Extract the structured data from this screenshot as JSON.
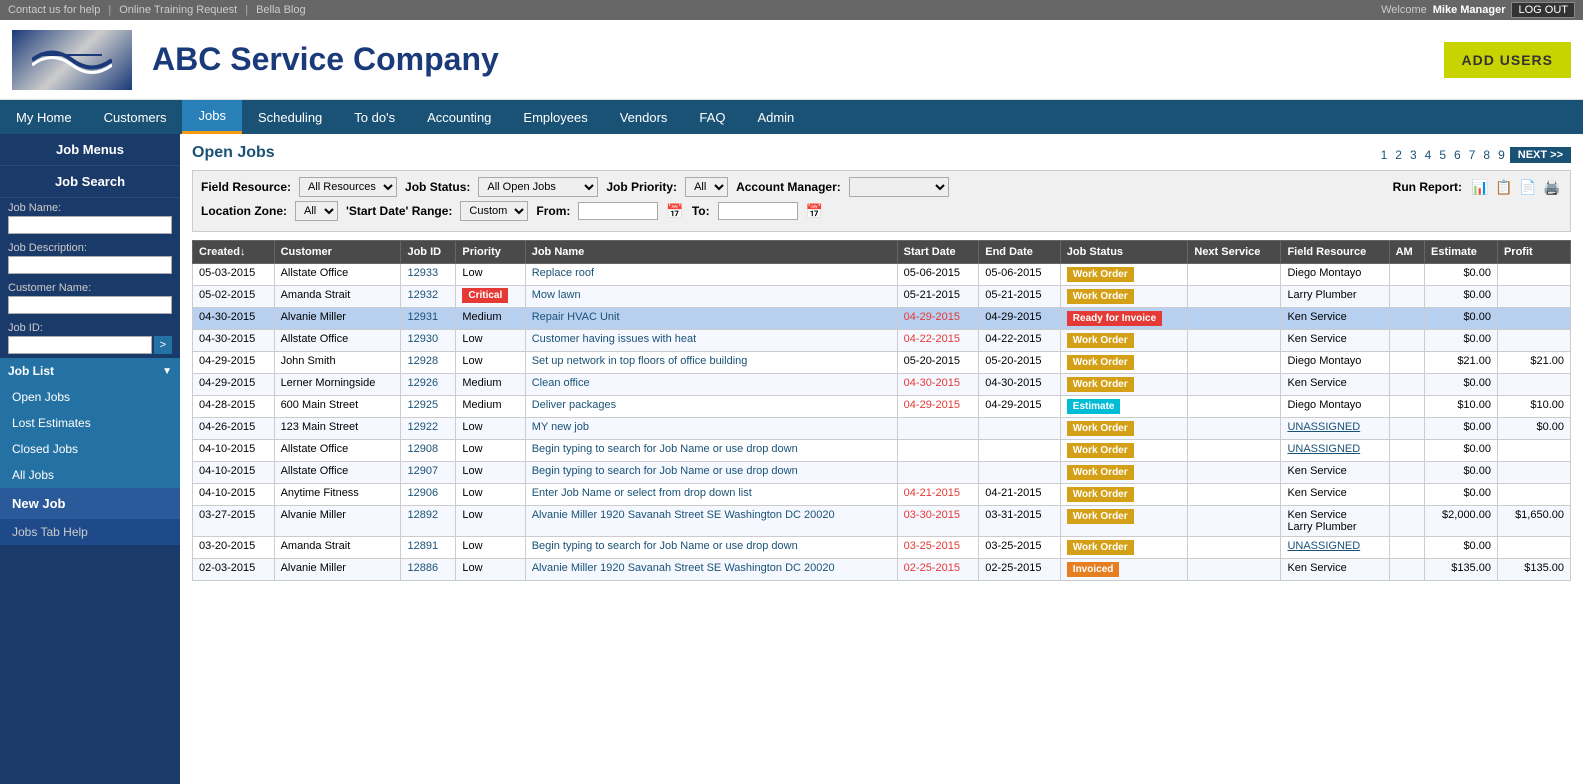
{
  "topBar": {
    "links": [
      "Contact us for help",
      "Online Training Request",
      "Bella Blog"
    ],
    "welcome": "Welcome",
    "user": "Mike Manager",
    "logout": "LOG OUT"
  },
  "header": {
    "companyName": "ABC Service Company",
    "addUsers": "ADD USERS"
  },
  "nav": {
    "items": [
      {
        "label": "My Home",
        "active": false
      },
      {
        "label": "Customers",
        "active": false
      },
      {
        "label": "Jobs",
        "active": true
      },
      {
        "label": "Scheduling",
        "active": false
      },
      {
        "label": "To do's",
        "active": false
      },
      {
        "label": "Accounting",
        "active": false
      },
      {
        "label": "Employees",
        "active": false
      },
      {
        "label": "Vendors",
        "active": false
      },
      {
        "label": "FAQ",
        "active": false
      },
      {
        "label": "Admin",
        "active": false
      }
    ]
  },
  "sidebar": {
    "jobMenus": "Job Menus",
    "jobSearch": "Job Search",
    "fields": [
      {
        "label": "Job Name:",
        "placeholder": ""
      },
      {
        "label": "Job Description:",
        "placeholder": ""
      },
      {
        "label": "Customer Name:",
        "placeholder": ""
      },
      {
        "label": "Job ID:",
        "placeholder": ""
      }
    ],
    "jobList": "Job List",
    "items": [
      {
        "label": "Open Jobs",
        "active": true
      },
      {
        "label": "Lost Estimates",
        "active": false
      },
      {
        "label": "Closed Jobs",
        "active": false
      },
      {
        "label": "All Jobs",
        "active": false
      }
    ],
    "newJob": "New Job",
    "jobsTabHelp": "Jobs Tab Help"
  },
  "filters": {
    "fieldResourceLabel": "Field Resource:",
    "fieldResourceValue": "All Resources",
    "jobStatusLabel": "Job Status:",
    "jobStatusValue": "All Open Jobs",
    "jobPriorityLabel": "Job Priority:",
    "jobPriorityValue": "All",
    "accountManagerLabel": "Account Manager:",
    "accountManagerValue": "",
    "locationZoneLabel": "Location Zone:",
    "locationZoneValue": "All",
    "startDateRangeLabel": "'Start Date' Range:",
    "startDateRangeValue": "Custom",
    "fromLabel": "From:",
    "fromValue": "",
    "toLabel": "To:",
    "toValue": "",
    "runReport": "Run Report:"
  },
  "pagination": {
    "pages": [
      "1",
      "2",
      "3",
      "4",
      "5",
      "6",
      "7",
      "8",
      "9"
    ],
    "next": "NEXT >>"
  },
  "openJobsTitle": "Open Jobs",
  "table": {
    "headers": [
      "Created↓",
      "Customer",
      "Job ID",
      "Priority",
      "Job Name",
      "Start Date",
      "End Date",
      "Job Status",
      "Next Service",
      "Field Resource",
      "AM",
      "Estimate",
      "Profit"
    ],
    "rows": [
      {
        "created": "05-03-2015",
        "customer": "Allstate Office",
        "jobId": "12933",
        "priority": "Low",
        "priorityType": "low",
        "jobName": "Replace roof",
        "startDate": "05-06-2015",
        "startOverdue": false,
        "endDate": "05-06-2015",
        "jobStatus": "Work Order",
        "statusType": "work-order",
        "nextService": "",
        "fieldResource": "Diego Montayo",
        "am": "",
        "estimate": "$0.00",
        "profit": "",
        "highlight": false
      },
      {
        "created": "05-02-2015",
        "customer": "Amanda Strait",
        "jobId": "12932",
        "priority": "Critical",
        "priorityType": "critical",
        "jobName": "Mow lawn",
        "startDate": "05-21-2015",
        "startOverdue": false,
        "endDate": "05-21-2015",
        "jobStatus": "Work Order",
        "statusType": "work-order",
        "nextService": "",
        "fieldResource": "Larry Plumber",
        "am": "",
        "estimate": "$0.00",
        "profit": "",
        "highlight": false
      },
      {
        "created": "04-30-2015",
        "customer": "Alvanie Miller",
        "jobId": "12931",
        "priority": "Medium",
        "priorityType": "medium",
        "jobName": "Repair HVAC Unit",
        "startDate": "04-29-2015",
        "startOverdue": true,
        "endDate": "04-29-2015",
        "jobStatus": "Ready for Invoice",
        "statusType": "ready-invoice",
        "nextService": "",
        "fieldResource": "Ken Service",
        "am": "",
        "estimate": "$0.00",
        "profit": "",
        "highlight": true
      },
      {
        "created": "04-30-2015",
        "customer": "Allstate Office",
        "jobId": "12930",
        "priority": "Low",
        "priorityType": "low",
        "jobName": "Customer having issues with heat",
        "startDate": "04-22-2015",
        "startOverdue": true,
        "endDate": "04-22-2015",
        "jobStatus": "Work Order",
        "statusType": "work-order",
        "nextService": "",
        "fieldResource": "Ken Service",
        "am": "",
        "estimate": "$0.00",
        "profit": "",
        "highlight": false
      },
      {
        "created": "04-29-2015",
        "customer": "John Smith",
        "jobId": "12928",
        "priority": "Low",
        "priorityType": "low",
        "jobName": "Set up network in top floors of office building",
        "startDate": "05-20-2015",
        "startOverdue": false,
        "endDate": "05-20-2015",
        "jobStatus": "Work Order",
        "statusType": "work-order",
        "nextService": "",
        "fieldResource": "Diego Montayo",
        "am": "",
        "estimate": "$21.00",
        "profit": "$21.00",
        "highlight": false
      },
      {
        "created": "04-29-2015",
        "customer": "Lerner Morningside",
        "jobId": "12926",
        "priority": "Medium",
        "priorityType": "medium",
        "jobName": "Clean office",
        "startDate": "04-30-2015",
        "startOverdue": true,
        "endDate": "04-30-2015",
        "jobStatus": "Work Order",
        "statusType": "work-order",
        "nextService": "",
        "fieldResource": "Ken Service",
        "am": "",
        "estimate": "$0.00",
        "profit": "",
        "highlight": false
      },
      {
        "created": "04-28-2015",
        "customer": "600 Main Street",
        "jobId": "12925",
        "priority": "Medium",
        "priorityType": "medium",
        "jobName": "Deliver packages",
        "startDate": "04-29-2015",
        "startOverdue": true,
        "endDate": "04-29-2015",
        "jobStatus": "Estimate",
        "statusType": "estimate",
        "nextService": "",
        "fieldResource": "Diego Montayo",
        "am": "",
        "estimate": "$10.00",
        "profit": "$10.00",
        "highlight": false
      },
      {
        "created": "04-26-2015",
        "customer": "123 Main Street",
        "jobId": "12922",
        "priority": "Low",
        "priorityType": "low",
        "jobName": "MY new job",
        "startDate": "",
        "startOverdue": false,
        "endDate": "",
        "jobStatus": "Work Order",
        "statusType": "work-order",
        "nextService": "",
        "fieldResource": "UNASSIGNED",
        "am": "",
        "estimate": "$0.00",
        "profit": "$0.00",
        "highlight": false,
        "fieldResourceUnassigned": true
      },
      {
        "created": "04-10-2015",
        "customer": "Allstate Office",
        "jobId": "12908",
        "priority": "Low",
        "priorityType": "low",
        "jobName": "Begin typing to search for Job Name or use drop down",
        "startDate": "",
        "startOverdue": false,
        "endDate": "",
        "jobStatus": "Work Order",
        "statusType": "work-order",
        "nextService": "",
        "fieldResource": "UNASSIGNED",
        "am": "",
        "estimate": "$0.00",
        "profit": "",
        "highlight": false,
        "fieldResourceUnassigned": true
      },
      {
        "created": "04-10-2015",
        "customer": "Allstate Office",
        "jobId": "12907",
        "priority": "Low",
        "priorityType": "low",
        "jobName": "Begin typing to search for Job Name or use drop down",
        "startDate": "",
        "startOverdue": false,
        "endDate": "",
        "jobStatus": "Work Order",
        "statusType": "work-order",
        "nextService": "",
        "fieldResource": "Ken Service",
        "am": "",
        "estimate": "$0.00",
        "profit": "",
        "highlight": false
      },
      {
        "created": "04-10-2015",
        "customer": "Anytime Fitness",
        "jobId": "12906",
        "priority": "Low",
        "priorityType": "low",
        "jobName": "Enter Job Name or select from drop down list",
        "startDate": "04-21-2015",
        "startOverdue": true,
        "endDate": "04-21-2015",
        "jobStatus": "Work Order",
        "statusType": "work-order",
        "nextService": "",
        "fieldResource": "Ken Service",
        "am": "",
        "estimate": "$0.00",
        "profit": "",
        "highlight": false
      },
      {
        "created": "03-27-2015",
        "customer": "Alvanie Miller",
        "jobId": "12892",
        "priority": "Low",
        "priorityType": "low",
        "jobName": "Alvanie Miller 1920 Savanah Street SE Washington DC 20020",
        "startDate": "03-30-2015",
        "startOverdue": true,
        "endDate": "03-31-2015",
        "jobStatus": "Work Order",
        "statusType": "work-order",
        "nextService": "",
        "fieldResource": "Ken Service\nLarry Plumber",
        "am": "",
        "estimate": "$2,000.00",
        "profit": "$1,650.00",
        "highlight": false
      },
      {
        "created": "03-20-2015",
        "customer": "Amanda Strait",
        "jobId": "12891",
        "priority": "Low",
        "priorityType": "low",
        "jobName": "Begin typing to search for Job Name or use drop down",
        "startDate": "03-25-2015",
        "startOverdue": true,
        "endDate": "03-25-2015",
        "jobStatus": "Work Order",
        "statusType": "work-order",
        "nextService": "",
        "fieldResource": "UNASSIGNED",
        "am": "",
        "estimate": "$0.00",
        "profit": "",
        "highlight": false,
        "fieldResourceUnassigned": true
      },
      {
        "created": "02-03-2015",
        "customer": "Alvanie Miller",
        "jobId": "12886",
        "priority": "Low",
        "priorityType": "low",
        "jobName": "Alvanie Miller 1920 Savanah Street SE Washington DC 20020",
        "startDate": "02-25-2015",
        "startOverdue": true,
        "endDate": "02-25-2015",
        "jobStatus": "Invoiced",
        "statusType": "invoiced",
        "nextService": "",
        "fieldResource": "Ken Service",
        "am": "",
        "estimate": "$135.00",
        "profit": "$135.00",
        "highlight": false
      }
    ]
  }
}
